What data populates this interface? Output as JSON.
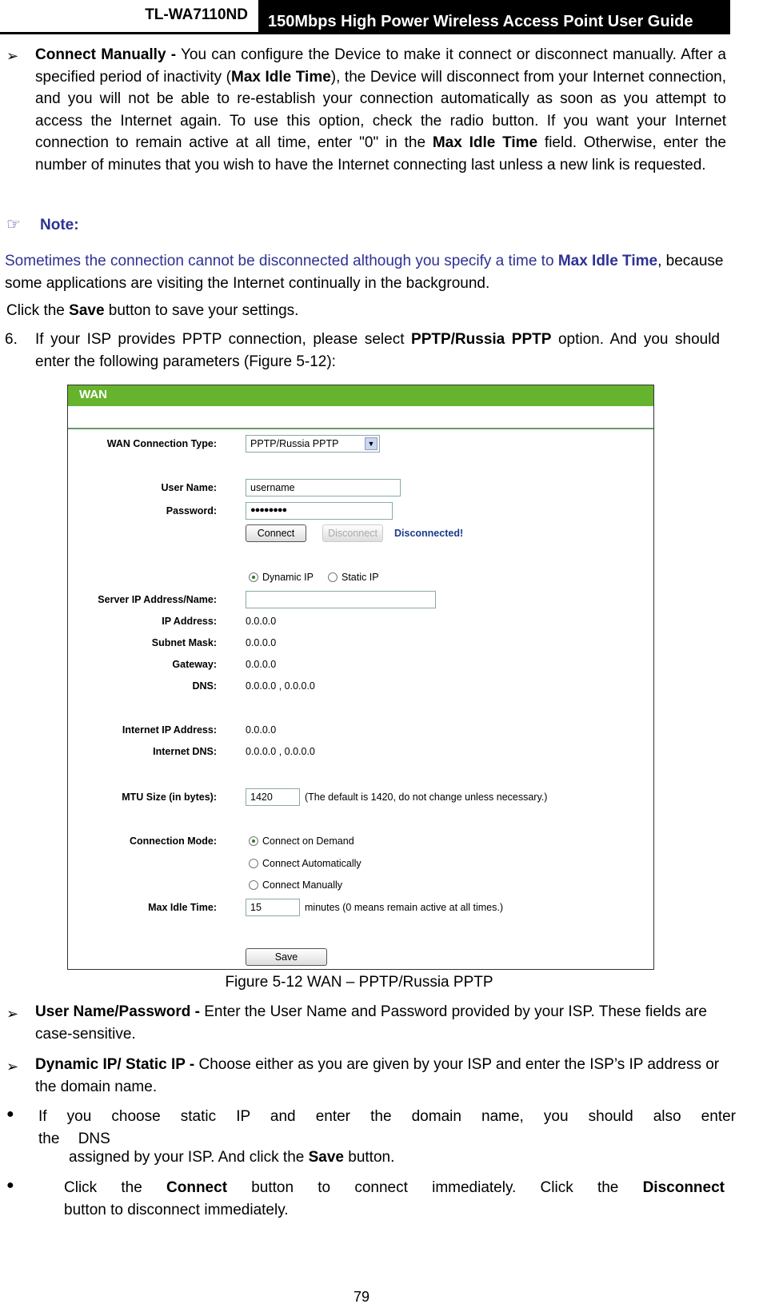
{
  "header": {
    "model": "TL-WA7110ND",
    "title": "150Mbps High Power Wireless Access Point User Guide"
  },
  "para1": {
    "term": "Connect Manually -",
    "t1": " You can configure the Device to make it connect or disconnect manually. After a specified period of inactivity (",
    "b1": "Max Idle Time",
    "t2": "), the Device will disconnect from your Internet connection, and you will not be able to re-establish your connection automatically as soon as you attempt to access the Internet again. To use this option, check the radio button. If you want your Internet connection to remain active at all time, enter \"0\" in the ",
    "b2": "Max Idle Time",
    "t3": " field. Otherwise, enter the number of minutes that you wish to have the Internet connecting last unless a new link is requested."
  },
  "note": {
    "label": "Note:",
    "t1": "Sometimes the connection cannot be disconnected although you specify a time to ",
    "b1": "Max Idle Time",
    "t2": ", because some applications are visiting the Internet continually in the background."
  },
  "save_line": {
    "t1": "Click the ",
    "b1": "Save",
    "t2": " button to save your settings."
  },
  "step6": {
    "num": "6.",
    "t1": "If your ISP provides PPTP connection, please select ",
    "b1": "PPTP/Russia PPTP",
    "t2": " option. And you should enter the following parameters (Figure 5-12):"
  },
  "figure": {
    "title": "WAN",
    "wan_type_label": "WAN Connection Type:",
    "wan_type_value": "PPTP/Russia PPTP",
    "username_label": "User Name:",
    "username_value": "username",
    "password_label": "Password:",
    "password_value": "●●●●●●●●",
    "connect": "Connect",
    "disconnect": "Disconnect",
    "status": "Disconnected!",
    "dynamic_ip": "Dynamic IP",
    "static_ip": "Static IP",
    "server_label": "Server IP Address/Name:",
    "ip_label": "IP Address:",
    "ip_value": "0.0.0.0",
    "subnet_label": "Subnet Mask:",
    "subnet_value": "0.0.0.0",
    "gateway_label": "Gateway:",
    "gateway_value": "0.0.0.0",
    "dns_label": "DNS:",
    "dns_value": "0.0.0.0 , 0.0.0.0",
    "inet_ip_label": "Internet IP Address:",
    "inet_ip_value": "0.0.0.0",
    "inet_dns_label": "Internet DNS:",
    "inet_dns_value": "0.0.0.0 , 0.0.0.0",
    "mtu_label": "MTU Size (in bytes):",
    "mtu_value": "1420",
    "mtu_hint": "(The default is 1420, do not change unless necessary.)",
    "mode_label": "Connection Mode:",
    "mode_demand": "Connect on Demand",
    "mode_auto": "Connect Automatically",
    "mode_manual": "Connect Manually",
    "idle_label": "Max Idle Time:",
    "idle_value": "15",
    "idle_hint": "minutes (0 means remain active at all times.)",
    "save": "Save"
  },
  "caption": "Figure 5-12 WAN – PPTP/Russia PPTP",
  "b_user": {
    "term": "User Name/Password -",
    "t": " Enter the User Name and Password provided by your ISP. These fields are case-sensitive."
  },
  "b_dyn": {
    "term": "Dynamic IP/ Static IP -",
    "t": " Choose either as you are given by your ISP and enter the ISP’s IP address or the domain name."
  },
  "sub1": {
    "t1": "If you choose static IP and enter the domain name, you should also enter the DNS",
    "t2": "assigned by your ISP. And click the ",
    "b1": "Save",
    "t3": " button."
  },
  "sub2": {
    "t1": "Click the ",
    "b1": "Connect",
    "t2": " button to connect immediately. Click the ",
    "b2": "Disconnect",
    "t3": " button to disconnect immediately."
  },
  "page_number": "79"
}
